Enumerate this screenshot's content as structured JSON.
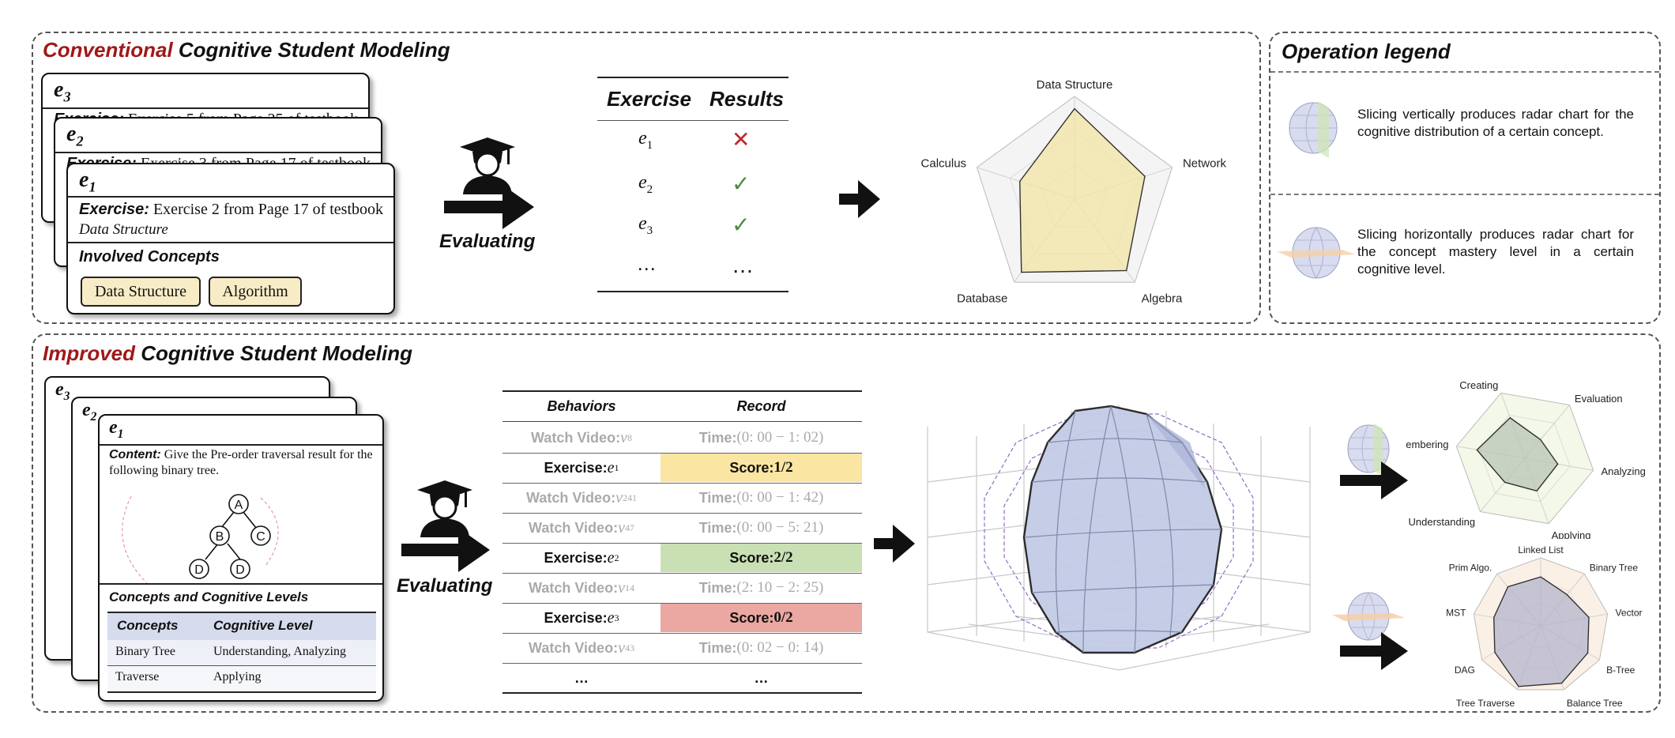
{
  "conventional": {
    "title_accent": "Conventional",
    "title_rest": " Cognitive Student Modeling",
    "cards": {
      "back2_label": "e",
      "back2_sub": "3",
      "back2_text_bold": "Exercise:",
      "back2_text": " Exercise 5 from Page 25 of testbook",
      "back1_label": "e",
      "back1_sub": "2",
      "back1_text_bold": "Exercise:",
      "back1_text": " Exercise 3 from Page 17 of testbook",
      "front_label": "e",
      "front_sub": "1",
      "front_text_bold": "Exercise:",
      "front_text": " Exercise 2 from Page 17 of testbook",
      "front_topic": "Data Structure",
      "concepts_heading": "Involved Concepts",
      "concept_1": "Data Structure",
      "concept_2": "Algorithm"
    },
    "evaluating_label": "Evaluating",
    "table": {
      "col_exercise": "Exercise",
      "col_results": "Results",
      "rows": [
        {
          "ex": "e",
          "sub": "1",
          "result": "✕"
        },
        {
          "ex": "e",
          "sub": "2",
          "result": "✓"
        },
        {
          "ex": "e",
          "sub": "3",
          "result": "✓"
        },
        {
          "ex": "…",
          "sub": "",
          "result": "…"
        }
      ]
    },
    "radar_labels": [
      "Data Structure",
      "Network",
      "Algebra",
      "Database",
      "Calculus"
    ]
  },
  "legend": {
    "title": "Operation legend",
    "item_1": "Slicing vertically produces radar chart for the cognitive distribution of a certain concept.",
    "item_2": "Slicing horizontally produces radar chart for the concept mastery level in a certain cognitive level."
  },
  "improved": {
    "title_accent": "Improved",
    "title_rest": " Cognitive Student Modeling",
    "cards": {
      "back2_label": "e",
      "back2_sub": "3",
      "back1_label": "e",
      "back1_sub": "2",
      "front_label": "e",
      "front_sub": "1",
      "content_bold": "Content:",
      "content_text": " Give the Pre-order traversal result for the following binary tree.",
      "tree_nodes": [
        "A",
        "B",
        "C",
        "D",
        "D"
      ],
      "levels_heading": "Concepts and Cognitive Levels",
      "col_concepts": "Concepts",
      "col_levels": "Cognitive Level",
      "rows": [
        {
          "concept": "Binary Tree",
          "level": "Understanding, Analyzing"
        },
        {
          "concept": "Traverse",
          "level": "Applying"
        }
      ]
    },
    "evaluating_label": "Evaluating",
    "table": {
      "col_behaviors": "Behaviors",
      "col_record": "Record",
      "rows": [
        {
          "left": "Watch Video: ",
          "lvar": "v",
          "lsub": "8",
          "right": "Time: ",
          "rval": "(0: 00 − 1: 02)",
          "kind": "watch"
        },
        {
          "left": "Exercise: ",
          "lvar": "e",
          "lsub": "1",
          "right": "Score: ",
          "rval": "1/2",
          "kind": "exercise",
          "color": "#fae6a2"
        },
        {
          "left": "Watch Video: ",
          "lvar": "v",
          "lsub": "241",
          "right": "Time: ",
          "rval": "(0: 00 − 1: 42)",
          "kind": "watch"
        },
        {
          "left": "Watch Video: ",
          "lvar": "v",
          "lsub": "47",
          "right": "Time: ",
          "rval": "(0: 00 − 5: 21)",
          "kind": "watch"
        },
        {
          "left": "Exercise: ",
          "lvar": "e",
          "lsub": "2",
          "right": "Score: ",
          "rval": "2/2",
          "kind": "exercise",
          "color": "#c9e0b5"
        },
        {
          "left": "Watch Video: ",
          "lvar": "v",
          "lsub": "14",
          "right": "Time: ",
          "rval": "(2: 10 − 2: 25)",
          "kind": "watch"
        },
        {
          "left": "Exercise: ",
          "lvar": "e",
          "lsub": "3",
          "right": "Score: ",
          "rval": "0/2",
          "kind": "exercise",
          "color": "#eba7a1"
        },
        {
          "left": "Watch Video: ",
          "lvar": "v",
          "lsub": "43",
          "right": "Time: ",
          "rval": "(0: 02 − 0: 14)",
          "kind": "watch"
        },
        {
          "left": "…",
          "lvar": "",
          "lsub": "",
          "right": "…",
          "rval": "",
          "kind": "ellipsis"
        }
      ]
    },
    "radar_vertical_labels": [
      "Creating",
      "Evaluation",
      "Analyzing",
      "Applying",
      "Understanding",
      "Remembering"
    ],
    "radar_horizontal_labels": [
      "Linked List",
      "Binary Tree",
      "Vector",
      "B-Tree",
      "Balance Tree",
      "Tree Traverse",
      "DAG",
      "MST",
      "Prim Algo."
    ]
  }
}
